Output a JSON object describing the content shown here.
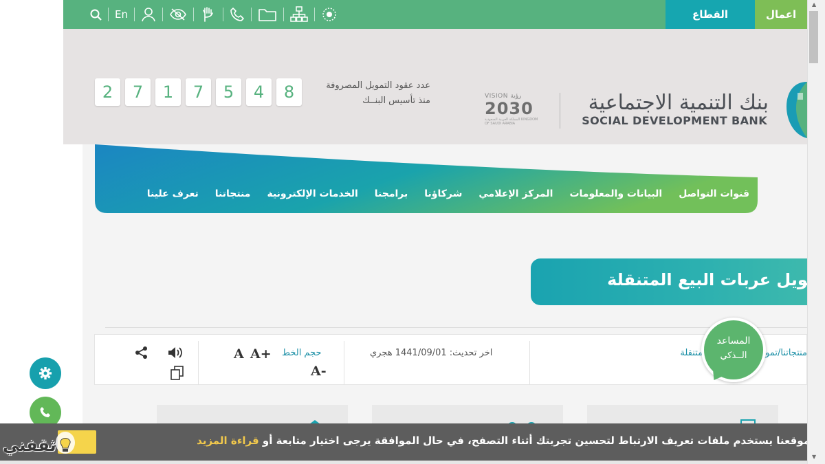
{
  "topbar": {
    "tabs": [
      {
        "label": "اعمال"
      },
      {
        "label": "القطاع الثالث"
      }
    ],
    "lang": "En",
    "icons": [
      "search-icon",
      "lang-toggle",
      "user-icon",
      "eye-slash-icon",
      "sign-language-icon",
      "phone-icon",
      "folder-icon",
      "sitemap-icon",
      "emblem-icon"
    ]
  },
  "brand": {
    "name_ar": "بنك التنمية الاجتماعية",
    "name_en": "SOCIAL DEVELOPMENT BANK",
    "vision_top": "VISION رؤية",
    "vision_year": "2030",
    "vision_sub": "المملكة العربية السعودية KINGDOM OF SAUDI ARABIA"
  },
  "counter": {
    "label_line1": "عدد عقود التمويل المصروفة",
    "label_line2": "منذ تأسيس البنــك",
    "digits": [
      "2",
      "7",
      "1",
      "7",
      "5",
      "4",
      "8"
    ]
  },
  "nav": {
    "items": [
      {
        "label": "تعرف علينا"
      },
      {
        "label": "منتجاتنا"
      },
      {
        "label": "الخدمات الإلكترونية"
      },
      {
        "label": "برامجنا"
      },
      {
        "label": "شركاؤنا"
      },
      {
        "label": "المركز الإعلامي"
      },
      {
        "label": "البيانات والمعلومات"
      },
      {
        "label": "قنوات التواصل"
      }
    ]
  },
  "page": {
    "title": "تمويل عربات البيع المتنقلة",
    "breadcrumb": "منتجاتنا/تمويل عربات البيع المتنقلة",
    "updated": "اخر تحديث: 1441/09/01 هجري",
    "font_size_label": "حجم الخط",
    "font_increase": "A+",
    "font_default": "A",
    "font_decrease": "A-"
  },
  "assistant": {
    "line1": "المساعد",
    "line2": "الــذكي"
  },
  "cookie": {
    "text": "موقعنا يستخدم ملفات تعريف الارتباط لتحسين تجربتك أثناء التصفح، في حال الموافقة يرجى اختيار متابعة أو ",
    "link": "قراءة المزيد"
  },
  "watermark": {
    "text": "ثقفني"
  },
  "colors": {
    "green": "#57b27f",
    "teal": "#16a6b0",
    "lime": "#7ebe56",
    "cookie_bg": "#5d5d5d",
    "link_yellow": "#f2c94c"
  }
}
